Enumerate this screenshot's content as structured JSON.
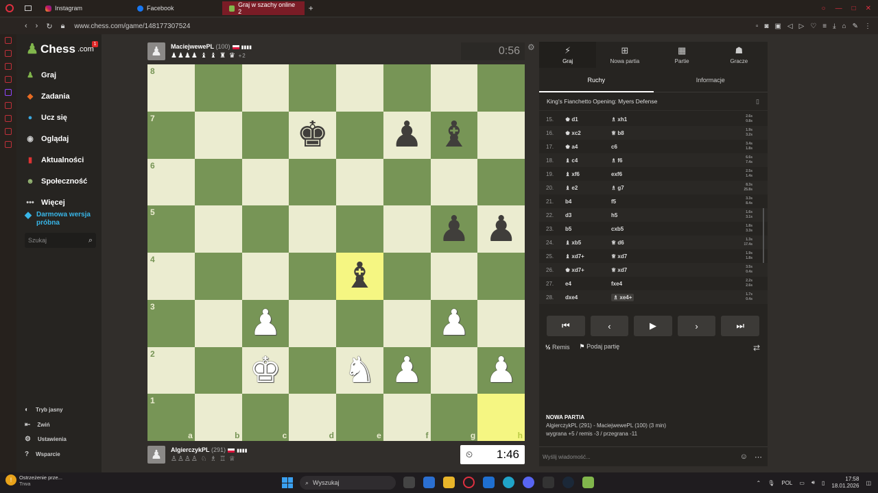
{
  "browser": {
    "tabs": [
      {
        "label": "Instagram",
        "icon": "instagram-icon"
      },
      {
        "label": "Facebook",
        "icon": "facebook-icon"
      },
      {
        "label": "Graj w szachy online 2",
        "icon": "chess-icon",
        "active": true
      }
    ],
    "url": "www.chess.com/game/148177307524"
  },
  "sidebar": {
    "logo": "Chess",
    "logo_suffix": ".com",
    "notification_count": "1",
    "menu": [
      {
        "label": "Graj",
        "icon": "play-icon",
        "color": "#81b64c"
      },
      {
        "label": "Zadania",
        "icon": "puzzle-icon",
        "color": "#e86b22"
      },
      {
        "label": "Ucz się",
        "icon": "learn-icon",
        "color": "#3aa8e0"
      },
      {
        "label": "Oglądaj",
        "icon": "watch-icon",
        "color": "#888888"
      },
      {
        "label": "Aktualności",
        "icon": "news-icon",
        "color": "#b33"
      },
      {
        "label": "Społeczność",
        "icon": "community-icon",
        "color": "#7a5"
      },
      {
        "label": "Więcej",
        "icon": "more-icon",
        "color": "#aaa"
      }
    ],
    "promo": "Darmowa wersja próbna",
    "search_placeholder": "Szukaj",
    "bottom_menu": [
      {
        "label": "Tryb jasny",
        "icon": "light-mode-icon"
      },
      {
        "label": "Zwiń",
        "icon": "collapse-icon"
      },
      {
        "label": "Ustawienia",
        "icon": "settings-icon"
      },
      {
        "label": "Wsparcie",
        "icon": "help-icon"
      }
    ]
  },
  "players": {
    "top": {
      "name": "MaciejwewePL",
      "rating": "(100)",
      "clock": "0:56",
      "captured": "♟♟♟♟ ♝ ♝ ♜ ♛",
      "advantage": "+2"
    },
    "bottom": {
      "name": "AlgierczykPL",
      "rating": "(291)",
      "clock": "1:46",
      "captured": "♙♙♙♙ ♘ ♗ ♖ ♕"
    }
  },
  "board": {
    "ranks": [
      "8",
      "7",
      "6",
      "5",
      "4",
      "3",
      "2",
      "1"
    ],
    "files": [
      "a",
      "b",
      "c",
      "d",
      "e",
      "f",
      "g",
      "h"
    ],
    "rows": [
      [
        "",
        "",
        "",
        "",
        "",
        "",
        "",
        ""
      ],
      [
        "",
        "",
        "",
        "bk",
        "",
        "bp",
        "bb",
        ""
      ],
      [
        "",
        "",
        "",
        "",
        "",
        "",
        "",
        ""
      ],
      [
        "",
        "",
        "",
        "",
        "",
        "",
        "bp",
        "bp"
      ],
      [
        "",
        "",
        "",
        "",
        "bb",
        "",
        "",
        ""
      ],
      [
        "",
        "",
        "wp",
        "",
        "",
        "",
        "wp",
        ""
      ],
      [
        "",
        "",
        "wk",
        "",
        "wn",
        "wp",
        "",
        "wp"
      ],
      [
        "",
        "",
        "",
        "",
        "",
        "",
        "",
        ""
      ]
    ],
    "highlights": [
      "e4",
      "h1"
    ]
  },
  "panel": {
    "tabs": [
      {
        "label": "Graj",
        "icon": "bolt-icon"
      },
      {
        "label": "Nowa partia",
        "icon": "plus-icon"
      },
      {
        "label": "Partie",
        "icon": "games-icon"
      },
      {
        "label": "Gracze",
        "icon": "players-icon"
      }
    ],
    "subtabs": [
      "Ruchy",
      "Informacje"
    ],
    "opening": "King's Fianchetto Opening: Myers Defense",
    "moves": [
      {
        "n": "15.",
        "w": "♚ d1",
        "b": "♗ xh1",
        "t1": "2.6s",
        "t2": "0.8s"
      },
      {
        "n": "16.",
        "w": "♚ xc2",
        "b": "♕ b8",
        "t1": "1.9s",
        "t2": "3.2s"
      },
      {
        "n": "17.",
        "w": "♚ a4",
        "b": "c6",
        "t1": "3.4s",
        "t2": "1.8s"
      },
      {
        "n": "18.",
        "w": "♝ c4",
        "b": "♗ f6",
        "t1": "6.6s",
        "t2": "7.4s"
      },
      {
        "n": "19.",
        "w": "♝ xf6",
        "b": "exf6",
        "t1": "2.5s",
        "t2": "1.4s"
      },
      {
        "n": "20.",
        "w": "♝ e2",
        "b": "♗ g7",
        "t1": "8.3s",
        "t2": "25.8s"
      },
      {
        "n": "21.",
        "w": "b4",
        "b": "f5",
        "t1": "3.3s",
        "t2": "8.4s"
      },
      {
        "n": "22.",
        "w": "d3",
        "b": "h5",
        "t1": "1.6s",
        "t2": "3.1s"
      },
      {
        "n": "23.",
        "w": "b5",
        "b": "cxb5",
        "t1": "1.8s",
        "t2": "3.3s"
      },
      {
        "n": "24.",
        "w": "♝ xb5",
        "b": "♕ d6",
        "t1": "1.3s",
        "t2": "17.4s"
      },
      {
        "n": "25.",
        "w": "♝ xd7+",
        "b": "♕ xd7",
        "t1": "1.9s",
        "t2": "1.8s"
      },
      {
        "n": "26.",
        "w": "♚ xd7+",
        "b": "♕ xd7",
        "t1": "3.5s",
        "t2": "0.4s"
      },
      {
        "n": "27.",
        "w": "e4",
        "b": "fxe4",
        "t1": "2.2s",
        "t2": "2.6s"
      },
      {
        "n": "28.",
        "w": "dxe4",
        "b": "♗ xe4+",
        "t1": "1.7s",
        "t2": "0.4s"
      }
    ],
    "draw_label": "Remis",
    "share_label": "Podaj partię",
    "new_game": {
      "title": "NOWA PARTIA",
      "line1": "AlgierczykPL (291) - MaciejwewePL (100) (3 min)",
      "line2": "wygrana +5 / remis -3 / przegrana -11"
    },
    "chat_placeholder": "Wyślij wiadomość..."
  },
  "taskbar": {
    "warning_title": "Ostrzeżenie prze...",
    "warning_sub": "Trwa",
    "search_placeholder": "Wyszukaj",
    "lang": "POL",
    "time": "17:58",
    "date": "18.01.2026"
  }
}
